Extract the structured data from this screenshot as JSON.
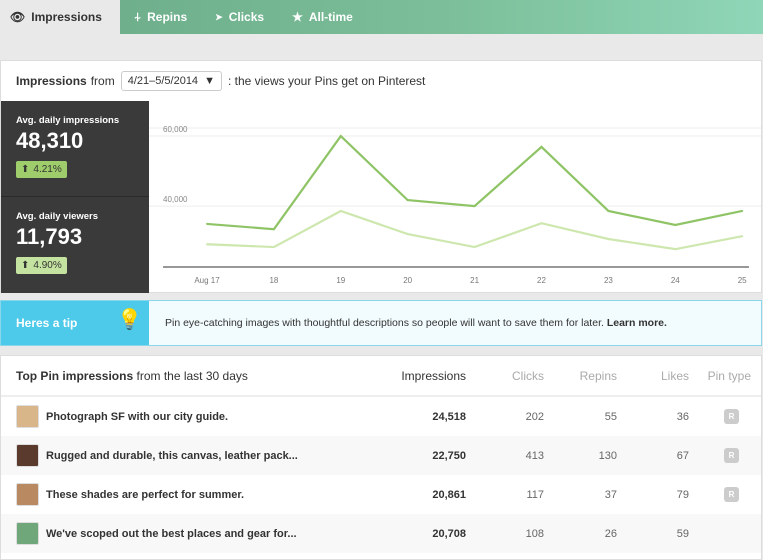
{
  "tabs": [
    {
      "label": "Impressions",
      "icon": "eye-icon"
    },
    {
      "label": "Repins",
      "icon": "pin-icon"
    },
    {
      "label": "Clicks",
      "icon": "cursor-icon"
    },
    {
      "label": "All-time",
      "icon": "star-icon"
    }
  ],
  "header": {
    "title": "Impressions",
    "from": "from",
    "date_range": "4/21–5/5/2014",
    "suffix": ": the views your Pins get on Pinterest"
  },
  "stats": [
    {
      "label": "Avg. daily impressions",
      "value": "48,310",
      "change": "4.21%"
    },
    {
      "label": "Avg. daily viewers",
      "value": "11,793",
      "change": "4.90%"
    }
  ],
  "chart_data": {
    "type": "line",
    "x": [
      "Aug 17",
      "18",
      "19",
      "20",
      "21",
      "22",
      "23",
      "24",
      "25"
    ],
    "yticks": [
      "60,000",
      "40,000"
    ],
    "ytick_values": [
      60000,
      40000
    ],
    "ylim": [
      22600,
      62300
    ],
    "series": [
      {
        "name": "Impressions",
        "color": "#8fc466",
        "values": [
          34900,
          33400,
          60000,
          41700,
          40000,
          56900,
          38600,
          34600,
          38600
        ]
      },
      {
        "name": "Viewers",
        "color": "#cde7ae",
        "values": [
          29100,
          28300,
          38600,
          32000,
          28300,
          35100,
          30600,
          27700,
          31400
        ]
      }
    ]
  },
  "tip": {
    "label": "Heres a tip",
    "text": "Pin eye-catching images with thoughtful descriptions so people will want to save them for later.",
    "link": "Learn more."
  },
  "table": {
    "title": "Top Pin impressions",
    "title_suffix": "from the last 30 days",
    "columns": [
      "Impressions",
      "Clicks",
      "Repins",
      "Likes",
      "Pin type"
    ],
    "rows": [
      {
        "title": "Photograph SF with our city guide.",
        "impressions": "24,518",
        "clicks": "202",
        "repins": "55",
        "likes": "36",
        "type": "R",
        "thumb": "#d9b58a"
      },
      {
        "title": "Rugged and durable, this canvas, leather pack...",
        "impressions": "22,750",
        "clicks": "413",
        "repins": "130",
        "likes": "67",
        "type": "R",
        "thumb": "#5a3a2c"
      },
      {
        "title": "These shades are perfect for summer.",
        "impressions": "20,861",
        "clicks": "117",
        "repins": "37",
        "likes": "79",
        "type": "R",
        "thumb": "#b98a62"
      },
      {
        "title": "We've scoped out the best places and gear for...",
        "impressions": "20,708",
        "clicks": "108",
        "repins": "26",
        "likes": "59",
        "type": null,
        "thumb": "#6fa77a"
      }
    ]
  }
}
